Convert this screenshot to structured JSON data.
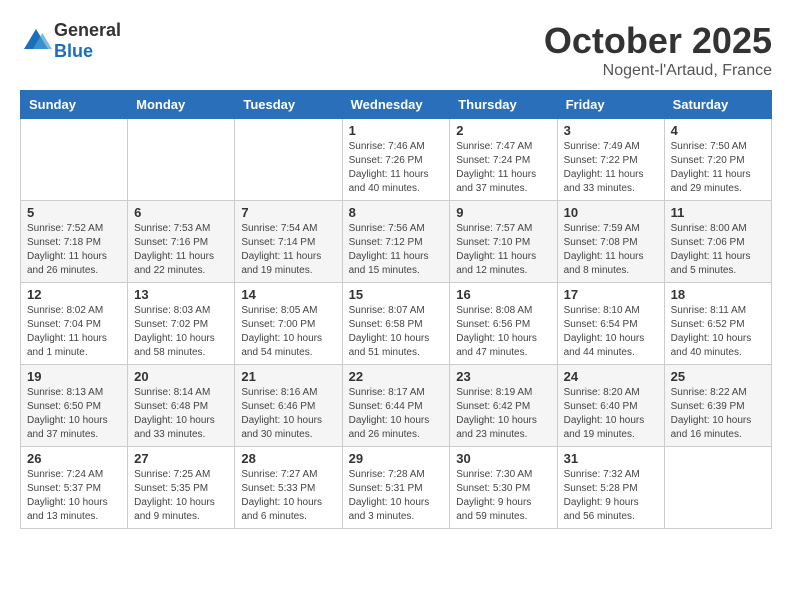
{
  "header": {
    "logo_general": "General",
    "logo_blue": "Blue",
    "month": "October 2025",
    "location": "Nogent-l'Artaud, France"
  },
  "weekdays": [
    "Sunday",
    "Monday",
    "Tuesday",
    "Wednesday",
    "Thursday",
    "Friday",
    "Saturday"
  ],
  "weeks": [
    [
      {
        "day": "",
        "sunrise": "",
        "sunset": "",
        "daylight": ""
      },
      {
        "day": "",
        "sunrise": "",
        "sunset": "",
        "daylight": ""
      },
      {
        "day": "",
        "sunrise": "",
        "sunset": "",
        "daylight": ""
      },
      {
        "day": "1",
        "sunrise": "Sunrise: 7:46 AM",
        "sunset": "Sunset: 7:26 PM",
        "daylight": "Daylight: 11 hours and 40 minutes."
      },
      {
        "day": "2",
        "sunrise": "Sunrise: 7:47 AM",
        "sunset": "Sunset: 7:24 PM",
        "daylight": "Daylight: 11 hours and 37 minutes."
      },
      {
        "day": "3",
        "sunrise": "Sunrise: 7:49 AM",
        "sunset": "Sunset: 7:22 PM",
        "daylight": "Daylight: 11 hours and 33 minutes."
      },
      {
        "day": "4",
        "sunrise": "Sunrise: 7:50 AM",
        "sunset": "Sunset: 7:20 PM",
        "daylight": "Daylight: 11 hours and 29 minutes."
      }
    ],
    [
      {
        "day": "5",
        "sunrise": "Sunrise: 7:52 AM",
        "sunset": "Sunset: 7:18 PM",
        "daylight": "Daylight: 11 hours and 26 minutes."
      },
      {
        "day": "6",
        "sunrise": "Sunrise: 7:53 AM",
        "sunset": "Sunset: 7:16 PM",
        "daylight": "Daylight: 11 hours and 22 minutes."
      },
      {
        "day": "7",
        "sunrise": "Sunrise: 7:54 AM",
        "sunset": "Sunset: 7:14 PM",
        "daylight": "Daylight: 11 hours and 19 minutes."
      },
      {
        "day": "8",
        "sunrise": "Sunrise: 7:56 AM",
        "sunset": "Sunset: 7:12 PM",
        "daylight": "Daylight: 11 hours and 15 minutes."
      },
      {
        "day": "9",
        "sunrise": "Sunrise: 7:57 AM",
        "sunset": "Sunset: 7:10 PM",
        "daylight": "Daylight: 11 hours and 12 minutes."
      },
      {
        "day": "10",
        "sunrise": "Sunrise: 7:59 AM",
        "sunset": "Sunset: 7:08 PM",
        "daylight": "Daylight: 11 hours and 8 minutes."
      },
      {
        "day": "11",
        "sunrise": "Sunrise: 8:00 AM",
        "sunset": "Sunset: 7:06 PM",
        "daylight": "Daylight: 11 hours and 5 minutes."
      }
    ],
    [
      {
        "day": "12",
        "sunrise": "Sunrise: 8:02 AM",
        "sunset": "Sunset: 7:04 PM",
        "daylight": "Daylight: 11 hours and 1 minute."
      },
      {
        "day": "13",
        "sunrise": "Sunrise: 8:03 AM",
        "sunset": "Sunset: 7:02 PM",
        "daylight": "Daylight: 10 hours and 58 minutes."
      },
      {
        "day": "14",
        "sunrise": "Sunrise: 8:05 AM",
        "sunset": "Sunset: 7:00 PM",
        "daylight": "Daylight: 10 hours and 54 minutes."
      },
      {
        "day": "15",
        "sunrise": "Sunrise: 8:07 AM",
        "sunset": "Sunset: 6:58 PM",
        "daylight": "Daylight: 10 hours and 51 minutes."
      },
      {
        "day": "16",
        "sunrise": "Sunrise: 8:08 AM",
        "sunset": "Sunset: 6:56 PM",
        "daylight": "Daylight: 10 hours and 47 minutes."
      },
      {
        "day": "17",
        "sunrise": "Sunrise: 8:10 AM",
        "sunset": "Sunset: 6:54 PM",
        "daylight": "Daylight: 10 hours and 44 minutes."
      },
      {
        "day": "18",
        "sunrise": "Sunrise: 8:11 AM",
        "sunset": "Sunset: 6:52 PM",
        "daylight": "Daylight: 10 hours and 40 minutes."
      }
    ],
    [
      {
        "day": "19",
        "sunrise": "Sunrise: 8:13 AM",
        "sunset": "Sunset: 6:50 PM",
        "daylight": "Daylight: 10 hours and 37 minutes."
      },
      {
        "day": "20",
        "sunrise": "Sunrise: 8:14 AM",
        "sunset": "Sunset: 6:48 PM",
        "daylight": "Daylight: 10 hours and 33 minutes."
      },
      {
        "day": "21",
        "sunrise": "Sunrise: 8:16 AM",
        "sunset": "Sunset: 6:46 PM",
        "daylight": "Daylight: 10 hours and 30 minutes."
      },
      {
        "day": "22",
        "sunrise": "Sunrise: 8:17 AM",
        "sunset": "Sunset: 6:44 PM",
        "daylight": "Daylight: 10 hours and 26 minutes."
      },
      {
        "day": "23",
        "sunrise": "Sunrise: 8:19 AM",
        "sunset": "Sunset: 6:42 PM",
        "daylight": "Daylight: 10 hours and 23 minutes."
      },
      {
        "day": "24",
        "sunrise": "Sunrise: 8:20 AM",
        "sunset": "Sunset: 6:40 PM",
        "daylight": "Daylight: 10 hours and 19 minutes."
      },
      {
        "day": "25",
        "sunrise": "Sunrise: 8:22 AM",
        "sunset": "Sunset: 6:39 PM",
        "daylight": "Daylight: 10 hours and 16 minutes."
      }
    ],
    [
      {
        "day": "26",
        "sunrise": "Sunrise: 7:24 AM",
        "sunset": "Sunset: 5:37 PM",
        "daylight": "Daylight: 10 hours and 13 minutes."
      },
      {
        "day": "27",
        "sunrise": "Sunrise: 7:25 AM",
        "sunset": "Sunset: 5:35 PM",
        "daylight": "Daylight: 10 hours and 9 minutes."
      },
      {
        "day": "28",
        "sunrise": "Sunrise: 7:27 AM",
        "sunset": "Sunset: 5:33 PM",
        "daylight": "Daylight: 10 hours and 6 minutes."
      },
      {
        "day": "29",
        "sunrise": "Sunrise: 7:28 AM",
        "sunset": "Sunset: 5:31 PM",
        "daylight": "Daylight: 10 hours and 3 minutes."
      },
      {
        "day": "30",
        "sunrise": "Sunrise: 7:30 AM",
        "sunset": "Sunset: 5:30 PM",
        "daylight": "Daylight: 9 hours and 59 minutes."
      },
      {
        "day": "31",
        "sunrise": "Sunrise: 7:32 AM",
        "sunset": "Sunset: 5:28 PM",
        "daylight": "Daylight: 9 hours and 56 minutes."
      },
      {
        "day": "",
        "sunrise": "",
        "sunset": "",
        "daylight": ""
      }
    ]
  ]
}
